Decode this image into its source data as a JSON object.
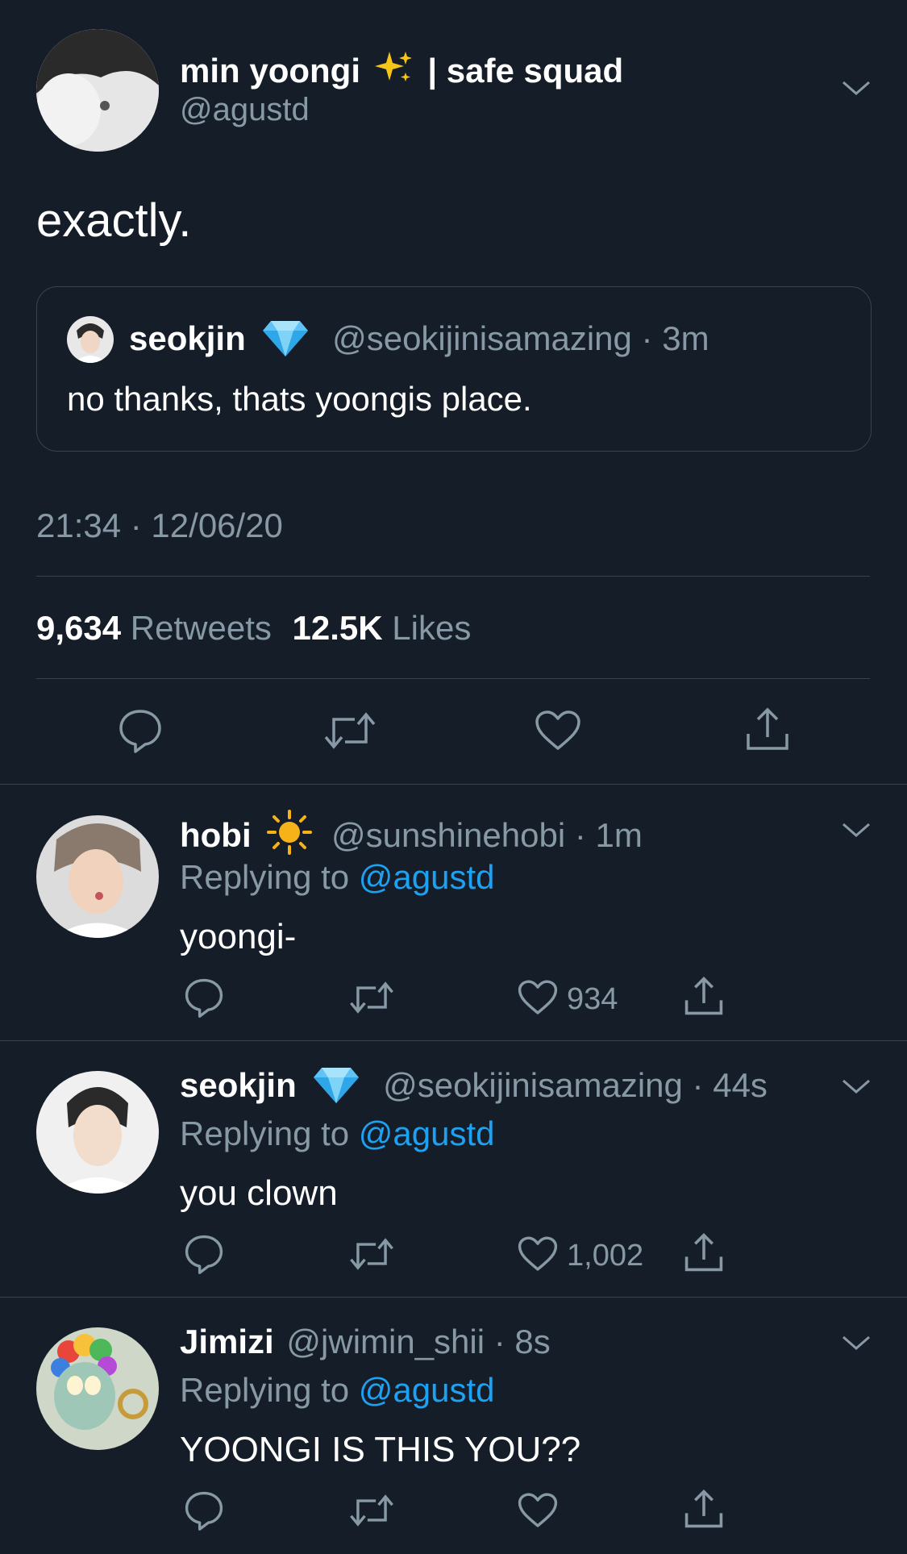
{
  "main_tweet": {
    "display_name": "min yoongi",
    "name_suffix": "| safe squad",
    "handle": "@agustd",
    "text": "exactly.",
    "timestamp": "21:34 · 12/06/20",
    "retweets_count": "9,634",
    "retweets_label": "Retweets",
    "likes_count": "12.5K",
    "likes_label": "Likes",
    "emoji": "sparkles-icon"
  },
  "quoted_tweet": {
    "display_name": "seokjin",
    "handle": "@seokijinisamazing",
    "dot": "·",
    "time": "3m",
    "text": "no thanks, thats yoongis place.",
    "emoji": "gem-icon"
  },
  "replies": [
    {
      "display_name": "hobi",
      "emoji": "sun-icon",
      "handle": "@sunshinehobi",
      "dot": "·",
      "time": "1m",
      "replying_label": "Replying to",
      "replying_handle": "@agustd",
      "text": "yoongi-",
      "like_count": "934"
    },
    {
      "display_name": "seokjin",
      "emoji": "gem-icon",
      "handle": "@seokijinisamazing",
      "dot": "·",
      "time": "44s",
      "replying_label": "Replying to",
      "replying_handle": "@agustd",
      "text": "you clown",
      "like_count": "1,002"
    },
    {
      "display_name": "Jimizi",
      "emoji": "",
      "handle": "@jwimin_shii",
      "dot": "·",
      "time": "8s",
      "replying_label": "Replying to",
      "replying_handle": "@agustd",
      "text": "YOONGI IS THIS YOU??",
      "like_count": ""
    }
  ],
  "colors": {
    "background": "#151d28",
    "accent": "#1da1f2",
    "muted": "#8899a6",
    "divider": "#38444d"
  }
}
